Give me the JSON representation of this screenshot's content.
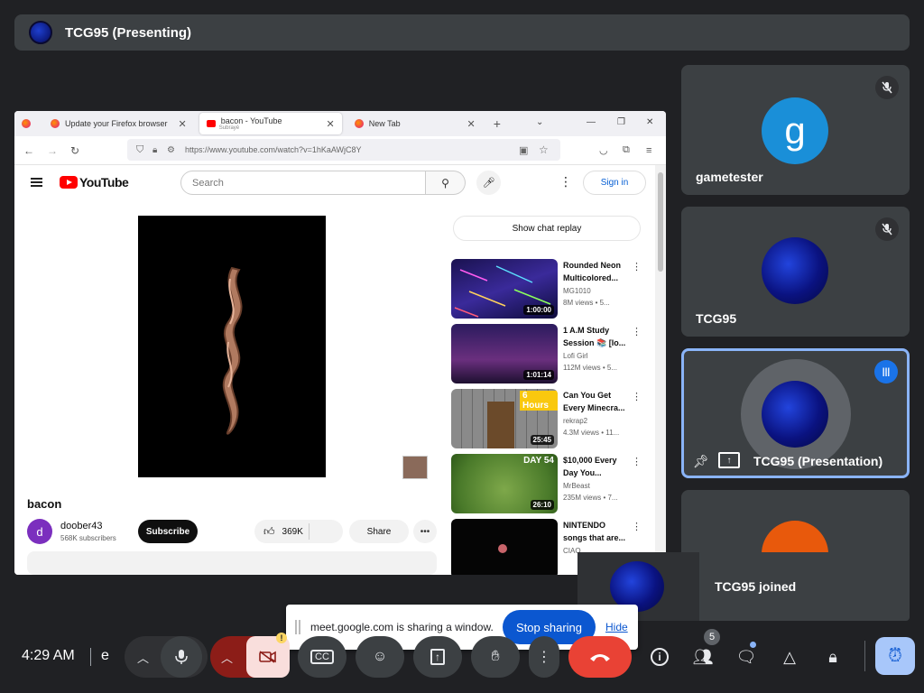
{
  "presenter_bar": {
    "title": "TCG95 (Presenting)"
  },
  "browser": {
    "tabs": [
      {
        "label": "Update your Firefox browser"
      },
      {
        "label": "bacon - YouTube",
        "sub": "Subrayé"
      },
      {
        "label": "New Tab"
      }
    ],
    "url": "https://www.youtube.com/watch?v=1hKaAWjC8Y"
  },
  "youtube": {
    "search_placeholder": "Search",
    "sign_in": "Sign in",
    "video_title": "bacon",
    "channel_initial": "d",
    "channel_name": "doober43",
    "subscribers": "568K subscribers",
    "subscribe": "Subscribe",
    "likes": "369K",
    "share": "Share",
    "chat_replay": "Show chat replay",
    "recommendations": [
      {
        "title1": "Rounded Neon",
        "title2": "Multicolored...",
        "channel": "MG1010",
        "meta": "8M views • 5...",
        "duration": "1:00:00"
      },
      {
        "title1": "1 A.M Study",
        "title2": "Session 📚 [lo...",
        "channel": "Lofi Girl",
        "meta": "112M views • 5...",
        "duration": "1:01:14"
      },
      {
        "title1": "Can You Get",
        "title2": "Every Minecra...",
        "channel": "rekrap2",
        "meta": "4.3M views • 11...",
        "duration": "25:45"
      },
      {
        "title1": "$10,000 Every",
        "title2": "Day You...",
        "channel": "MrBeast",
        "meta": "235M views • 7...",
        "duration": "26:10"
      },
      {
        "title1": "NINTENDO",
        "title2": "songs that are...",
        "channel": "CIAO",
        "meta": "",
        "duration": ""
      }
    ]
  },
  "participants": [
    {
      "name": "gametester",
      "initial": "g"
    },
    {
      "name": "TCG95"
    },
    {
      "name": "TCG95 (Presentation)"
    }
  ],
  "toast": {
    "text": "TCG95 joined"
  },
  "share_banner": {
    "message": "meet.google.com is sharing a window.",
    "stop": "Stop sharing",
    "hide": "Hide"
  },
  "controls": {
    "time": "4:29 AM",
    "meeting_code": "e",
    "people_count": "5",
    "warning": "!"
  },
  "colors": {
    "meet_bg": "#202124",
    "tile_bg": "#3c4043",
    "accent_blue": "#0b57d0",
    "end_call_red": "#e94235",
    "yt_red": "#ff0000"
  }
}
